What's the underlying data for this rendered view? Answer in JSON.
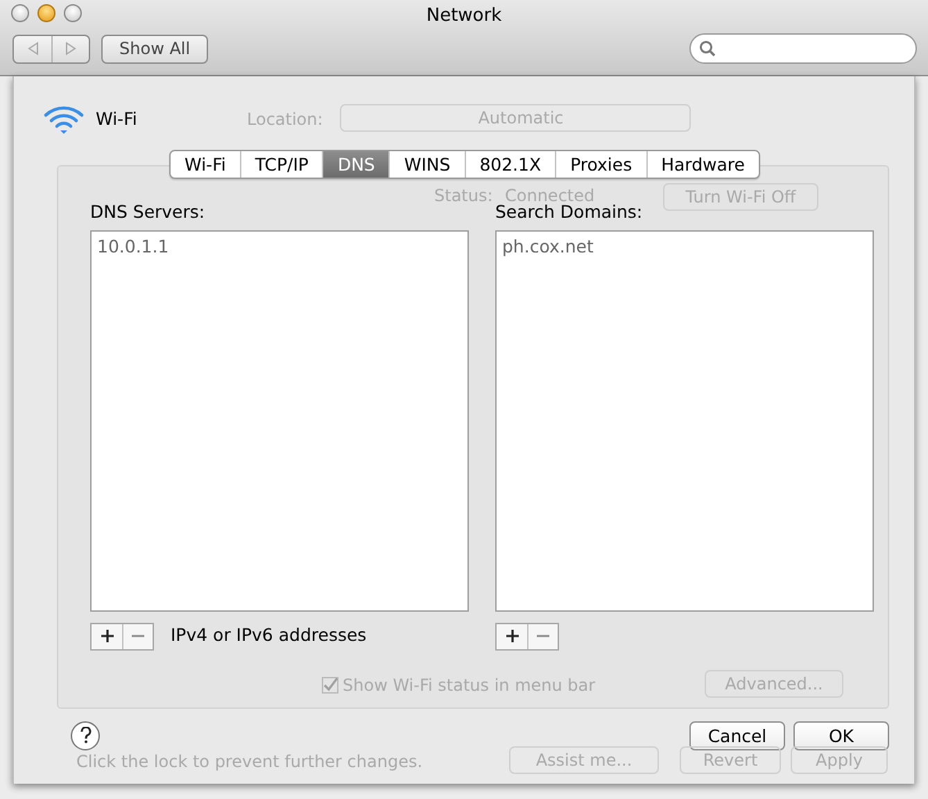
{
  "window": {
    "title": "Network",
    "show_all": "Show All"
  },
  "service": {
    "name": "Wi-Fi"
  },
  "tabs": [
    {
      "label": "Wi-Fi",
      "selected": false
    },
    {
      "label": "TCP/IP",
      "selected": false
    },
    {
      "label": "DNS",
      "selected": true
    },
    {
      "label": "WINS",
      "selected": false
    },
    {
      "label": "802.1X",
      "selected": false
    },
    {
      "label": "Proxies",
      "selected": false
    },
    {
      "label": "Hardware",
      "selected": false
    }
  ],
  "dns_servers": {
    "label": "DNS Servers:",
    "items": [
      "10.0.1.1"
    ],
    "hint": "IPv4 or IPv6 addresses"
  },
  "search_domains": {
    "label": "Search Domains:",
    "items": [
      "ph.cox.net"
    ]
  },
  "buttons": [
    "Cancel",
    "OK"
  ],
  "background": [
    {
      "text": "Location:",
      "kind": "label"
    },
    {
      "text": "Automatic",
      "kind": "popup"
    },
    {
      "text": "Status:",
      "kind": "label"
    },
    {
      "text": "Connected",
      "kind": "label"
    },
    {
      "text": "Turn Wi-Fi Off",
      "kind": "button"
    },
    {
      "text": "Show Wi-Fi status in menu bar",
      "kind": "check",
      "checked": true
    },
    {
      "text": "Advanced...",
      "kind": "button"
    },
    {
      "text": "Click the lock to prevent further changes.",
      "kind": "label"
    },
    {
      "text": "Assist me...",
      "kind": "button"
    },
    {
      "text": "Revert",
      "kind": "button"
    },
    {
      "text": "Apply",
      "kind": "button"
    }
  ]
}
